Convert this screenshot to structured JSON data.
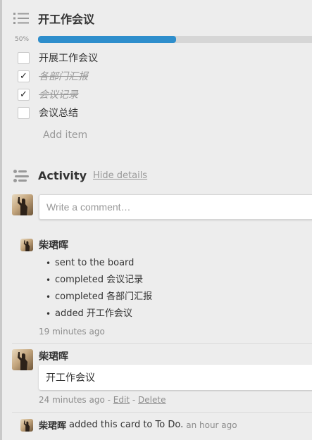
{
  "checklist": {
    "title": "开工作会议",
    "progress_label": "50%",
    "progress_value": 0.5,
    "items": [
      {
        "text": "开展工作会议",
        "checked": false
      },
      {
        "text": "各部门汇报",
        "checked": true
      },
      {
        "text": "会议记录",
        "checked": true
      },
      {
        "text": "会议总结",
        "checked": false
      }
    ],
    "add_item_label": "Add item",
    "check_mark": "✓"
  },
  "activity": {
    "title": "Activity",
    "hide_details_label": "Hide details",
    "comment_placeholder": "Write a comment…",
    "entries": [
      {
        "user": "柴珺晖",
        "actions": [
          "sent to the board",
          "completed 会议记录",
          "completed 各部门汇报",
          "added 开工作会议"
        ],
        "time": "19 minutes ago"
      },
      {
        "user": "柴珺晖",
        "comment": "开工作会议",
        "time": "24 minutes ago",
        "separator": "-",
        "edit_label": "Edit",
        "delete_label": "Delete"
      },
      {
        "user": "柴珺晖",
        "text": "added this card to To Do.",
        "time": "an hour ago"
      }
    ]
  },
  "colors": {
    "accent": "#2e8ecc",
    "background": "#ededed"
  },
  "icons": {
    "checklist": "checklist-icon",
    "activity": "activity-icon",
    "avatar": "user-avatar"
  }
}
